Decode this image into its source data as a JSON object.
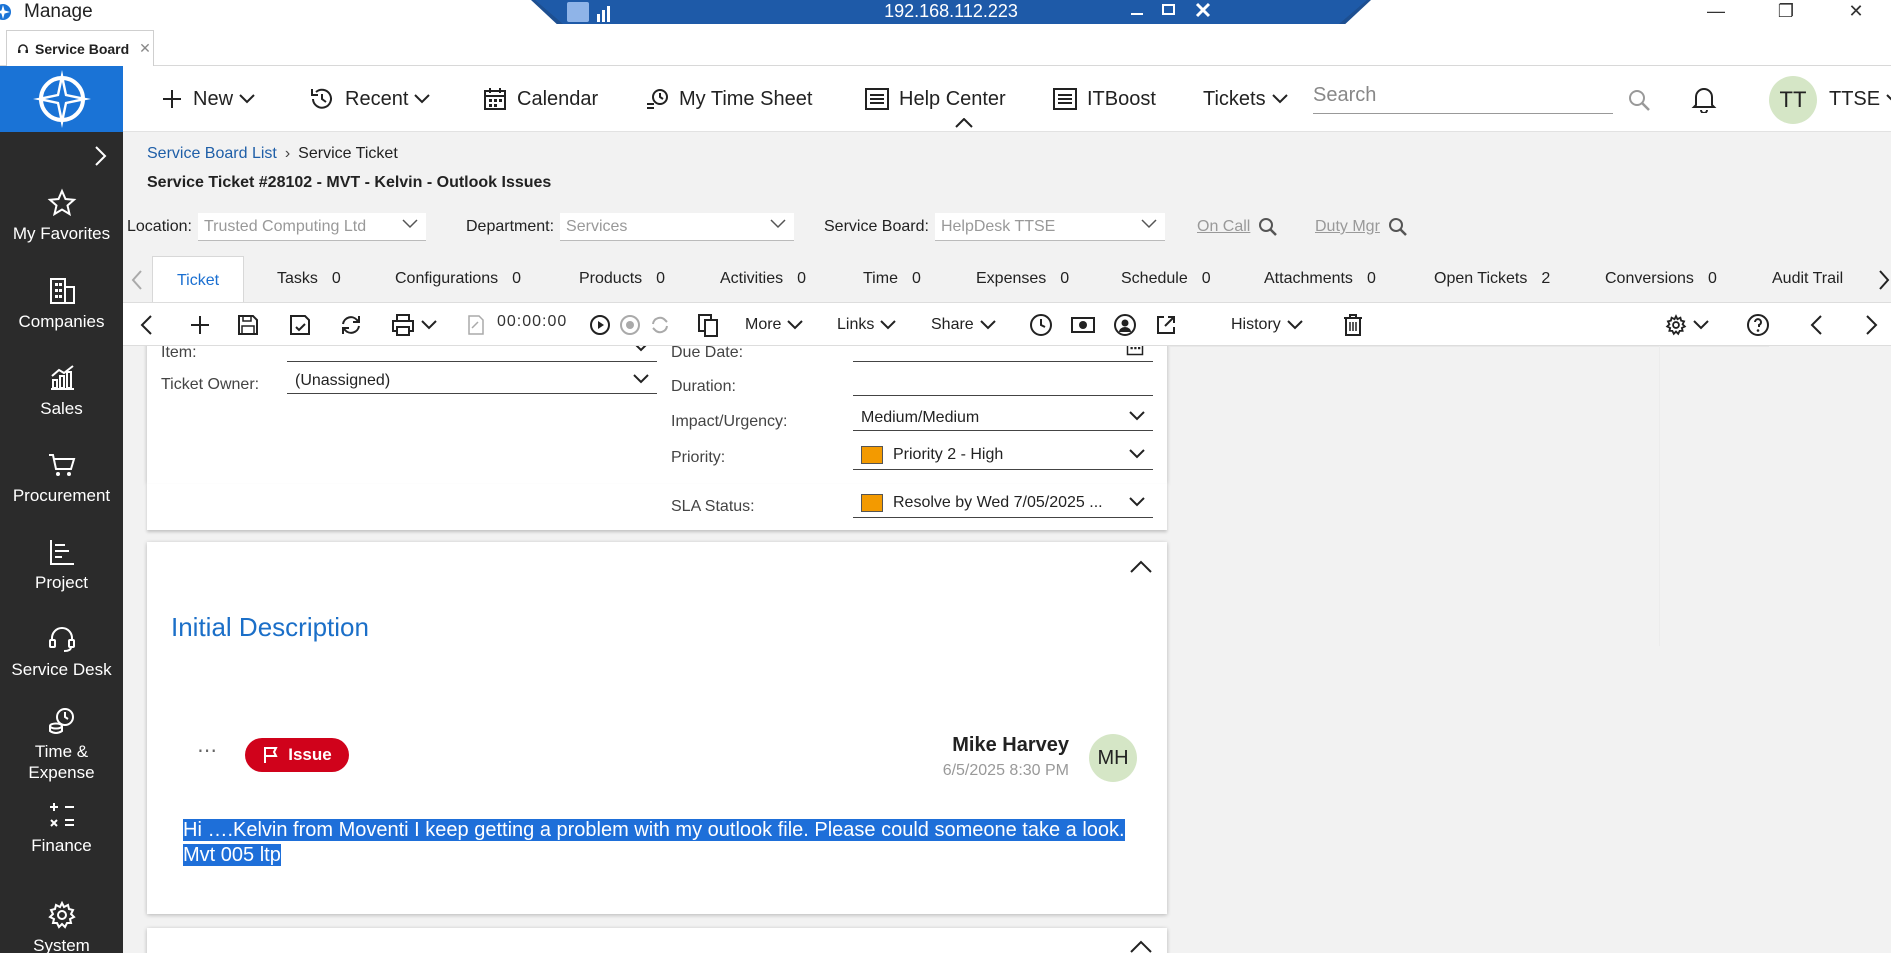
{
  "window": {
    "app_title": "Manage",
    "remote_ip": "192.168.112.223"
  },
  "browser_tab": {
    "label": "Service Board"
  },
  "leftnav": {
    "items": [
      {
        "label": "My Favorites",
        "icon": "star-icon"
      },
      {
        "label": "Companies",
        "icon": "building-icon"
      },
      {
        "label": "Sales",
        "icon": "chart-icon"
      },
      {
        "label": "Procurement",
        "icon": "cart-icon"
      },
      {
        "label": "Project",
        "icon": "gantt-icon"
      },
      {
        "label": "Service Desk",
        "icon": "headset-icon"
      },
      {
        "label": "Time &",
        "label2": "Expense",
        "icon": "clock-coin-icon"
      },
      {
        "label": "Finance",
        "icon": "calculator-icon"
      },
      {
        "label": "System",
        "icon": "gear-icon"
      }
    ]
  },
  "topnav": {
    "new": "New",
    "recent": "Recent",
    "calendar": "Calendar",
    "timesheet": "My Time Sheet",
    "help": "Help Center",
    "itboost": "ITBoost",
    "tickets": "Tickets",
    "search_placeholder": "Search",
    "user_initials": "TT",
    "user_name": "TTSE"
  },
  "breadcrumb": {
    "root": "Service Board List",
    "current": "Service Ticket"
  },
  "ticket_title": "Service Ticket #28102 - MVT - Kelvin - Outlook Issues",
  "filters": {
    "location_label": "Location:",
    "location_value": "Trusted Computing Ltd",
    "department_label": "Department:",
    "department_value": "Services",
    "board_label": "Service Board:",
    "board_value": "HelpDesk TTSE",
    "on_call": "On Call",
    "duty_mgr": "Duty Mgr"
  },
  "tabs": [
    {
      "label": "Ticket",
      "count": ""
    },
    {
      "label": "Tasks",
      "count": "0"
    },
    {
      "label": "Configurations",
      "count": "0"
    },
    {
      "label": "Products",
      "count": "0"
    },
    {
      "label": "Activities",
      "count": "0"
    },
    {
      "label": "Time",
      "count": "0"
    },
    {
      "label": "Expenses",
      "count": "0"
    },
    {
      "label": "Schedule",
      "count": "0"
    },
    {
      "label": "Attachments",
      "count": "0"
    },
    {
      "label": "Open Tickets",
      "count": "2"
    },
    {
      "label": "Conversions",
      "count": "0"
    },
    {
      "label": "Audit Trail",
      "count": ""
    }
  ],
  "toolbar": {
    "timer": "00:00:00",
    "more": "More",
    "links": "Links",
    "share": "Share",
    "history": "History"
  },
  "fields": {
    "item_label": "Item:",
    "owner_label": "Ticket Owner:",
    "owner_value": "(Unassigned)",
    "due_label": "Due Date:",
    "duration_label": "Duration:",
    "impact_label": "Impact/Urgency:",
    "impact_value": "Medium/Medium",
    "priority_label": "Priority:",
    "priority_value": "Priority 2 - High",
    "sla_label": "SLA Status:",
    "sla_value": "Resolve by Wed 7/05/2025 ...",
    "accent_color": "#f39a00"
  },
  "description": {
    "heading": "Initial Description",
    "badge": "Issue",
    "author": "Mike Harvey",
    "time": "6/5/2025 8:30 PM",
    "initials": "MH",
    "text": "Hi ….Kelvin from Moventi I keep getting a problem with my outlook file. Please could someone take a look. Mvt 005 ltp"
  },
  "colors": {
    "brand_blue": "#1a73d6",
    "nav_dark": "#2b2b2b",
    "issue_red": "#d0021b",
    "link_blue": "#1f5fa8"
  }
}
